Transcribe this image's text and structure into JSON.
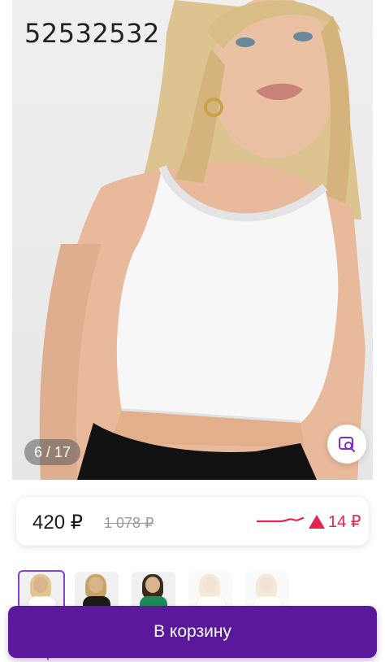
{
  "product": {
    "article": "52532532",
    "image_counter": "6 / 17",
    "image_description_icon": "model-photo"
  },
  "price": {
    "current": "420 ₽",
    "old": "1 078 ₽",
    "change": "14 ₽",
    "change_direction": "up",
    "accent_color": "#e6244f"
  },
  "thumbnails": [
    {
      "name": "thumb-1",
      "selected": true,
      "top_color": "#ffffff",
      "hair_color": "#e2c58f"
    },
    {
      "name": "thumb-2",
      "selected": false,
      "top_color": "#1a1a1a",
      "hair_color": "#c9a26a"
    },
    {
      "name": "thumb-3",
      "selected": false,
      "top_color": "#1f8a5a",
      "hair_color": "#3a2a1e"
    },
    {
      "name": "thumb-4",
      "selected": false,
      "top_color": "#ffffff",
      "hair_color": "#e2c58f"
    },
    {
      "name": "thumb-5",
      "selected": false,
      "top_color": "#ffffff",
      "hair_color": "#e2c58f"
    }
  ],
  "cart": {
    "label": "В корзину",
    "color": "#5a189a"
  },
  "color_label": "Цвет белый"
}
